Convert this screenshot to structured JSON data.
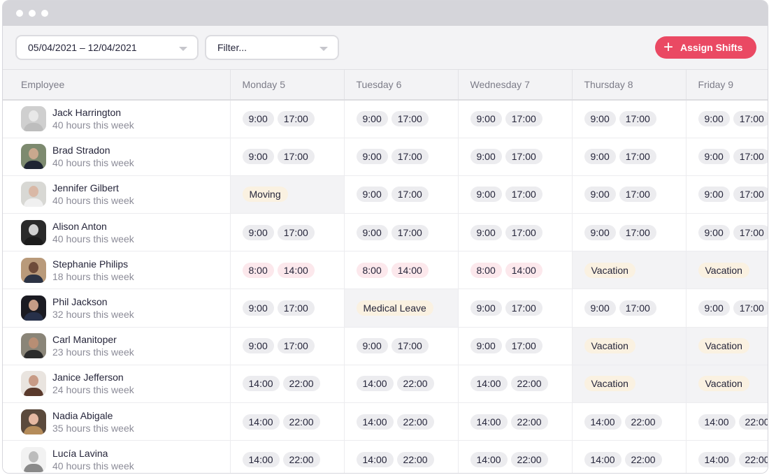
{
  "window": {
    "controls": [
      "dot",
      "dot",
      "dot"
    ]
  },
  "toolbar": {
    "date_range": "05/04/2021 – 12/04/2021",
    "filter_placeholder": "Filter...",
    "assign_label": "Assign Shifts",
    "assign_icon": "plus-icon",
    "accent_color": "#ea4963"
  },
  "columns": [
    "Employee",
    "Monday 5",
    "Tuesday 6",
    "Wednesday 7",
    "Thursday 8",
    "Friday 9"
  ],
  "employees": [
    {
      "name": "Jack Harrington",
      "hours": "40 hours this week",
      "avatar": [
        "#cfcfcf",
        "#e8e8e8",
        "#bdbdbd"
      ],
      "days": [
        [
          "9:00",
          "17:00"
        ],
        [
          "9:00",
          "17:00"
        ],
        [
          "9:00",
          "17:00"
        ],
        [
          "9:00",
          "17:00"
        ],
        [
          "9:00",
          "17:00"
        ]
      ]
    },
    {
      "name": "Brad Stradon",
      "hours": "40 hours this week",
      "avatar": [
        "#7d8a6f",
        "#c9a88e",
        "#1f2533"
      ],
      "days": [
        [
          "9:00",
          "17:00"
        ],
        [
          "9:00",
          "17:00"
        ],
        [
          "9:00",
          "17:00"
        ],
        [
          "9:00",
          "17:00"
        ],
        [
          "9:00",
          "17:00"
        ]
      ]
    },
    {
      "name": "Jennifer Gilbert",
      "hours": "40 hours this week",
      "avatar": [
        "#d8d8d4",
        "#d9b8a6",
        "#f0f0f0"
      ],
      "days": [
        {
          "status": "Moving"
        },
        [
          "9:00",
          "17:00"
        ],
        [
          "9:00",
          "17:00"
        ],
        [
          "9:00",
          "17:00"
        ],
        [
          "9:00",
          "17:00"
        ]
      ]
    },
    {
      "name": "Alison Anton",
      "hours": "40 hours this week",
      "avatar": [
        "#2a2a2a",
        "#d0d0d0",
        "#1c1c1c"
      ],
      "days": [
        [
          "9:00",
          "17:00"
        ],
        [
          "9:00",
          "17:00"
        ],
        [
          "9:00",
          "17:00"
        ],
        [
          "9:00",
          "17:00"
        ],
        [
          "9:00",
          "17:00"
        ]
      ]
    },
    {
      "name": "Stephanie Philips",
      "hours": "18 hours this week",
      "avatar": [
        "#b99a7a",
        "#6e4b3a",
        "#2c3344"
      ],
      "days": [
        [
          "8:00",
          "14:00",
          "pink"
        ],
        [
          "8:00",
          "14:00",
          "pink"
        ],
        [
          "8:00",
          "14:00",
          "pink"
        ],
        {
          "status": "Vacation"
        },
        {
          "status": "Vacation"
        }
      ]
    },
    {
      "name": "Phil Jackson",
      "hours": "32 hours this week",
      "avatar": [
        "#1b1b22",
        "#c59c86",
        "#273049"
      ],
      "days": [
        [
          "9:00",
          "17:00"
        ],
        {
          "status": "Medical Leave"
        },
        [
          "9:00",
          "17:00"
        ],
        [
          "9:00",
          "17:00"
        ],
        [
          "9:00",
          "17:00"
        ]
      ]
    },
    {
      "name": "Carl Manitoper",
      "hours": "23 hours this week",
      "avatar": [
        "#8a8578",
        "#b88e74",
        "#2b2b2b"
      ],
      "days": [
        [
          "9:00",
          "17:00"
        ],
        [
          "9:00",
          "17:00"
        ],
        [
          "9:00",
          "17:00"
        ],
        {
          "status": "Vacation"
        },
        {
          "status": "Vacation"
        }
      ]
    },
    {
      "name": "Janice Jefferson",
      "hours": "24 hours this week",
      "avatar": [
        "#e9e4df",
        "#c89b86",
        "#5a3a2c"
      ],
      "days": [
        [
          "14:00",
          "22:00"
        ],
        [
          "14:00",
          "22:00"
        ],
        [
          "14:00",
          "22:00"
        ],
        {
          "status": "Vacation"
        },
        {
          "status": "Vacation"
        }
      ]
    },
    {
      "name": "Nadia Abigale",
      "hours": "35 hours this week",
      "avatar": [
        "#5b4a3c",
        "#e6b9a2",
        "#b58c5a"
      ],
      "days": [
        [
          "14:00",
          "22:00"
        ],
        [
          "14:00",
          "22:00"
        ],
        [
          "14:00",
          "22:00"
        ],
        [
          "14:00",
          "22:00"
        ],
        [
          "14:00",
          "22:00"
        ]
      ]
    },
    {
      "name": "Lucía Lavina",
      "hours": "40 hours this week",
      "avatar": [
        "#f2f2f2",
        "#bcbcbc",
        "#8a8a8a"
      ],
      "days": [
        [
          "14:00",
          "22:00"
        ],
        [
          "14:00",
          "22:00"
        ],
        [
          "14:00",
          "22:00"
        ],
        [
          "14:00",
          "22:00"
        ],
        [
          "14:00",
          "22:00"
        ]
      ]
    }
  ]
}
